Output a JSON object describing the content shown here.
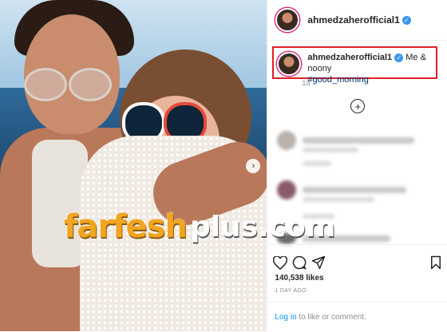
{
  "photo": {
    "alt_icon": "photo-of-man-and-child",
    "next_icon": "chevron-right-icon"
  },
  "watermark": {
    "part1": "farfesh",
    "part2": "plus.com",
    "color_orange": "#f2a51f"
  },
  "header": {
    "username": "ahmedzaherofficial1",
    "verified_icon": "verified-badge-icon"
  },
  "caption": {
    "username": "ahmedzaherofficial1",
    "text": "Me & noony",
    "hashtag": "#good_morning",
    "time": "1d",
    "highlight_color": "#e01f26"
  },
  "comments": {
    "load_more_icon": "plus-circle-icon"
  },
  "actions": {
    "like_icon": "heart-icon",
    "comment_icon": "comment-icon",
    "share_icon": "paper-plane-icon",
    "save_icon": "bookmark-icon"
  },
  "stats": {
    "likes": "140,538 likes",
    "posted": "1 DAY AGO"
  },
  "footer": {
    "login_link": "Log in",
    "login_rest": " to like or comment."
  },
  "colors": {
    "link": "#0095f6",
    "verified": "#3897f0",
    "hashtag": "#00376b",
    "muted": "#8e8e8e"
  }
}
